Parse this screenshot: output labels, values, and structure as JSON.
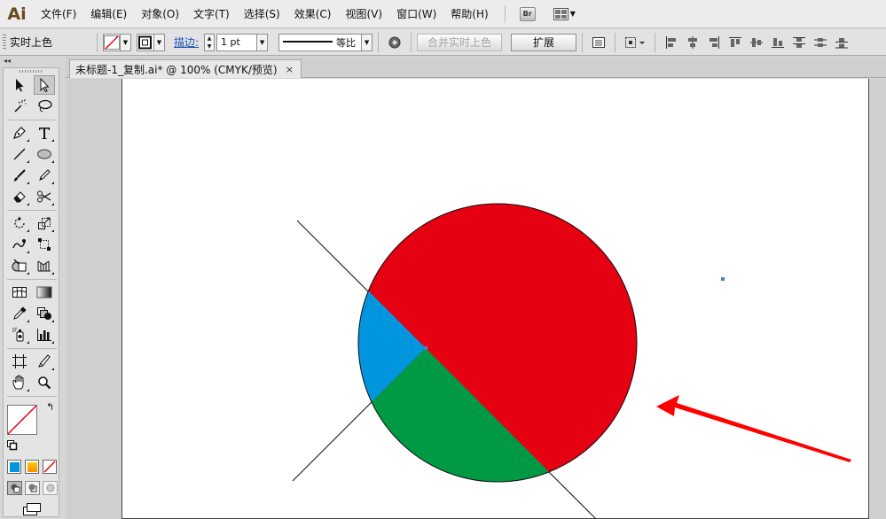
{
  "app": {
    "logo": "Ai"
  },
  "menu": {
    "items": [
      {
        "label": "文件(F)",
        "name": "menu-file"
      },
      {
        "label": "编辑(E)",
        "name": "menu-edit"
      },
      {
        "label": "对象(O)",
        "name": "menu-object"
      },
      {
        "label": "文字(T)",
        "name": "menu-type"
      },
      {
        "label": "选择(S)",
        "name": "menu-select"
      },
      {
        "label": "效果(C)",
        "name": "menu-effect"
      },
      {
        "label": "视图(V)",
        "name": "menu-view"
      },
      {
        "label": "窗口(W)",
        "name": "menu-window"
      },
      {
        "label": "帮助(H)",
        "name": "menu-help"
      }
    ],
    "bridge_label": "Br"
  },
  "control_bar": {
    "title": "实时上色",
    "stroke_label": "描边:",
    "stroke_weight": "1 pt",
    "stroke_profile": "等比",
    "merge_button": "合并实时上色",
    "expand_button": "扩展"
  },
  "document": {
    "tab_title": "未标题-1_复制.ai* @ 100% (CMYK/预览)",
    "close_glyph": "×"
  },
  "colors": {
    "red": "#e50012",
    "blue": "#0095dc",
    "green": "#009944",
    "annotation_arrow": "#ff0000",
    "selection": "#4a7fd6"
  },
  "icons": [
    "selection-tool-icon",
    "direct-selection-tool-icon",
    "magic-wand-tool-icon",
    "lasso-tool-icon",
    "pen-tool-icon",
    "type-tool-icon",
    "line-segment-tool-icon",
    "ellipse-tool-icon",
    "paintbrush-tool-icon",
    "pencil-tool-icon",
    "eraser-tool-icon",
    "scissors-tool-icon",
    "rotate-tool-icon",
    "scale-tool-icon",
    "warp-tool-icon",
    "free-transform-tool-icon",
    "shape-builder-tool-icon",
    "perspective-grid-tool-icon",
    "mesh-tool-icon",
    "gradient-tool-icon",
    "eyedropper-tool-icon",
    "blend-tool-icon",
    "symbol-sprayer-tool-icon",
    "column-graph-tool-icon",
    "artboard-tool-icon",
    "slice-tool-icon",
    "hand-tool-icon",
    "zoom-tool-icon"
  ]
}
